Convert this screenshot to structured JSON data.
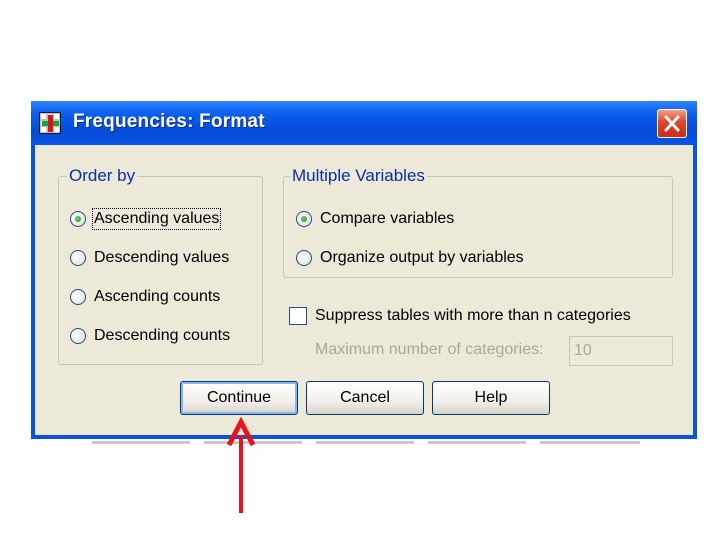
{
  "window": {
    "title": "Frequencies: Format",
    "close_icon": "close-x-icon",
    "app_icon": "spss-grid-icon"
  },
  "order_by": {
    "legend": "Order by",
    "options": [
      {
        "label": "Ascending values",
        "checked": true
      },
      {
        "label": "Descending values",
        "checked": false
      },
      {
        "label": "Ascending counts",
        "checked": false
      },
      {
        "label": "Descending counts",
        "checked": false
      }
    ]
  },
  "multiple_variables": {
    "legend": "Multiple Variables",
    "options": [
      {
        "label": "Compare variables",
        "checked": true
      },
      {
        "label": "Organize output by variables",
        "checked": false
      }
    ]
  },
  "suppress": {
    "label": "Suppress tables with more than n categories",
    "checked": false,
    "max_label": "Maximum number of categories:",
    "max_value": "10"
  },
  "buttons": {
    "continue": "Continue",
    "cancel": "Cancel",
    "help": "Help"
  },
  "annotation": {
    "arrow_color": "#e8141c",
    "arrow_icon": "up-arrow-icon"
  },
  "colors": {
    "titlebar": "#0a5ef0",
    "dialog_face": "#ece9d8",
    "group_legend": "#0a2ea8"
  }
}
